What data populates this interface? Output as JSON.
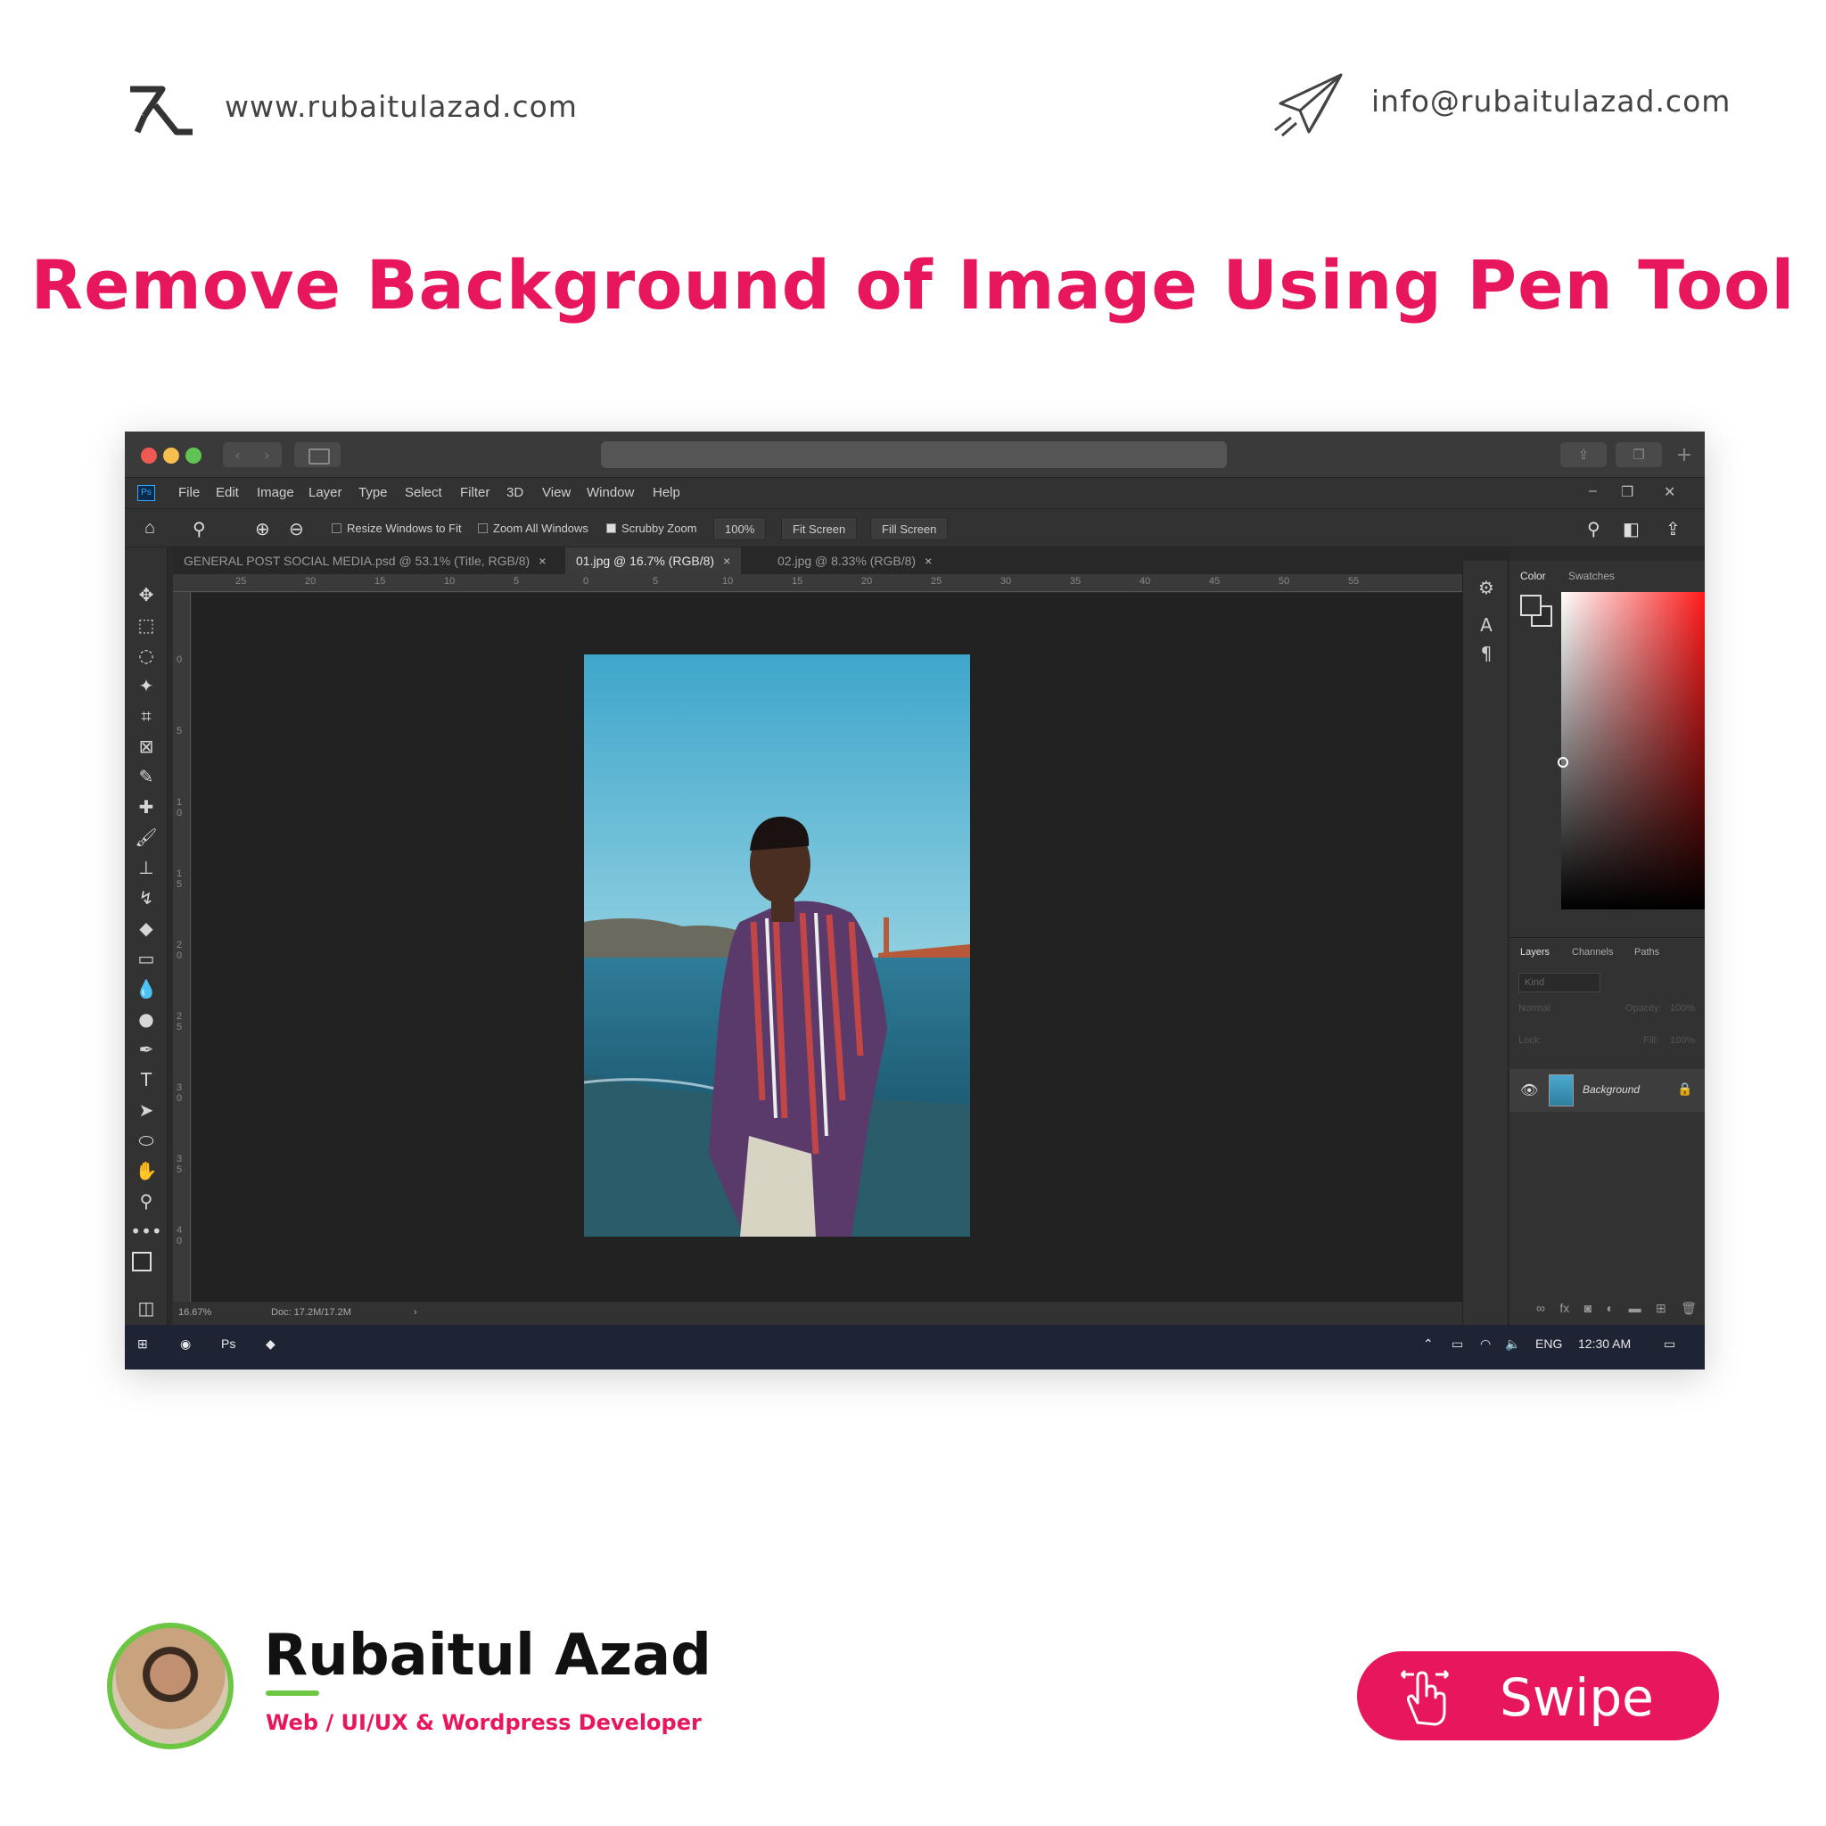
{
  "header": {
    "site_url": "www.rubaitulazad.com",
    "email": "info@rubaitulazad.com",
    "headline": "Remove Background of Image Using Pen Tool",
    "logo_icon": "ra-monogram-icon",
    "contact_icon": "paper-plane-icon"
  },
  "colors": {
    "accent": "#e8175d",
    "green": "#6cc644",
    "ps_dark": "#2b2b2b"
  },
  "photoshop": {
    "menu": [
      "File",
      "Edit",
      "Image",
      "Layer",
      "Type",
      "Select",
      "Filter",
      "3D",
      "View",
      "Window",
      "Help"
    ],
    "options": {
      "resize_windows": "Resize Windows to Fit",
      "zoom_all": "Zoom All Windows",
      "scrubby_zoom": "Scrubby Zoom",
      "zoom_value": "100%",
      "fit_screen": "Fit Screen",
      "fill_screen": "Fill Screen"
    },
    "tabs": [
      {
        "label": "GENERAL POST SOCIAL MEDIA.psd @ 53.1% (Title, RGB/8)",
        "active": false
      },
      {
        "label": "01.jpg @ 16.7% (RGB/8)",
        "active": true
      },
      {
        "label": "02.jpg @ 8.33% (RGB/8)",
        "active": false
      }
    ],
    "ruler_top": [
      "25",
      "20",
      "15",
      "10",
      "5",
      "0",
      "5",
      "10",
      "15",
      "20",
      "25",
      "30",
      "35",
      "40",
      "45",
      "50",
      "55"
    ],
    "ruler_left": [
      "0",
      "5",
      "1 0",
      "1 5",
      "2 0",
      "2 5",
      "3 0",
      "3 5",
      "4 0"
    ],
    "status": {
      "zoom": "16.67%",
      "doc": "Doc: 17.2M/17.2M"
    },
    "color_panel": {
      "tabs": [
        "Color",
        "Swatches"
      ]
    },
    "layers_panel": {
      "tabs": [
        "Layers",
        "Channels",
        "Paths"
      ],
      "search_placeholder": "Kind",
      "blend_mode": "Normal",
      "opacity_label": "Opacity:",
      "opacity_value": "100%",
      "lock_label": "Lock:",
      "fill_label": "Fill:",
      "fill_value": "100%",
      "layer_name": "Background"
    },
    "taskbar": {
      "lang": "ENG",
      "time": "12:30 AM"
    }
  },
  "footer": {
    "author": "Rubaitul Azad",
    "role": "Web / UI/UX & Wordpress Developer",
    "swipe": "Swipe"
  }
}
